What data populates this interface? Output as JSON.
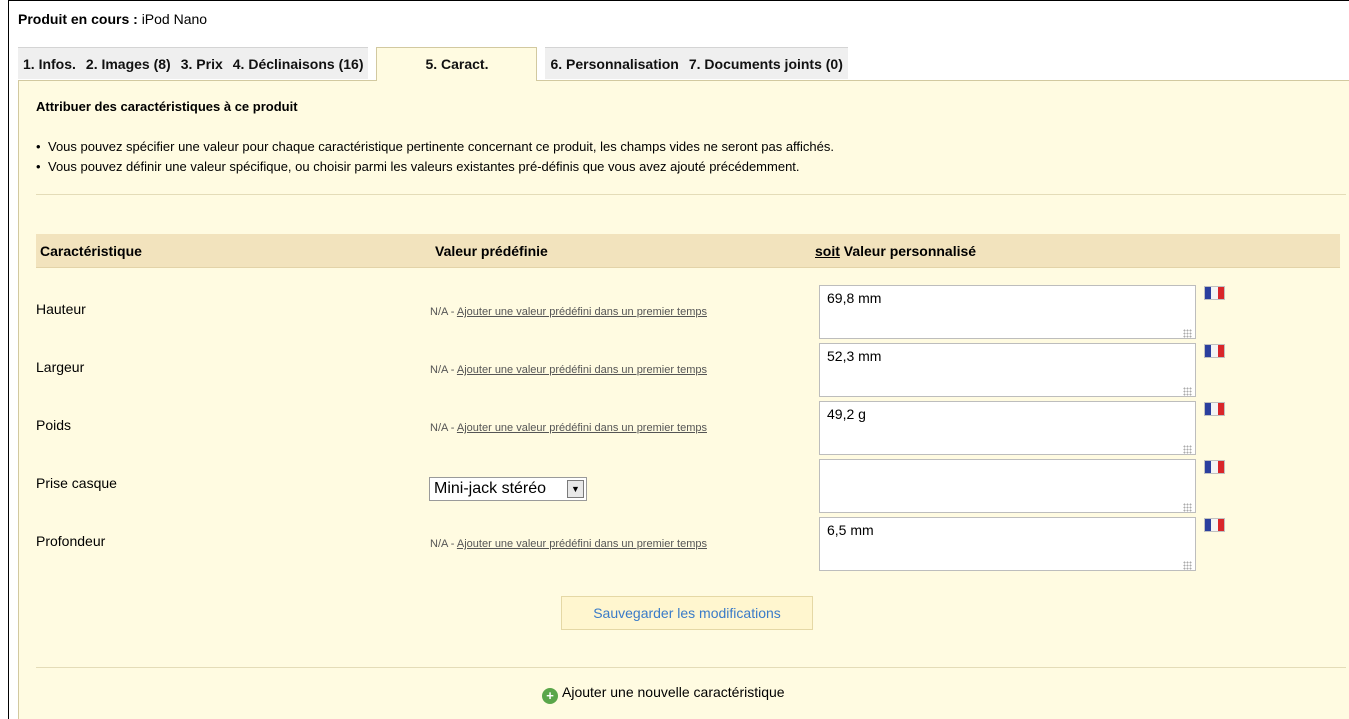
{
  "product": {
    "label": "Produit en cours :",
    "name": "iPod Nano"
  },
  "tabs": [
    {
      "label": "1. Infos."
    },
    {
      "label": "2. Images (8)"
    },
    {
      "label": "3. Prix"
    },
    {
      "label": "4. Déclinaisons (16)"
    },
    {
      "label": "5. Caract.",
      "active": true
    },
    {
      "label": "6. Personnalisation"
    },
    {
      "label": "7. Documents joints (0)"
    }
  ],
  "section": {
    "title": "Attribuer des caractéristiques à ce produit",
    "bullets": [
      "Vous pouvez spécifier une valeur pour chaque caractéristique pertinente concernant ce produit, les champs vides ne seront pas affichés.",
      "Vous pouvez définir une valeur spécifique, ou choisir parmi les valeurs existantes pré-définis que vous avez ajouté précédemment."
    ]
  },
  "table": {
    "headers": {
      "feature": "Caractéristique",
      "predefined": "Valeur prédéfinie",
      "soit": "soit",
      "custom": "Valeur personnalisé"
    },
    "na_text": "N/A -",
    "na_link": "Ajouter une valeur prédéfini dans un premier temps",
    "rows": [
      {
        "name": "Hauteur",
        "custom_value": "69,8 mm"
      },
      {
        "name": "Largeur",
        "custom_value": "52,3 mm"
      },
      {
        "name": "Poids",
        "custom_value": "49,2 g"
      },
      {
        "name": "Prise casque",
        "predefined_select": "Mini-jack stéréo",
        "custom_value": ""
      },
      {
        "name": "Profondeur",
        "custom_value": "6,5 mm"
      }
    ]
  },
  "save_button": "Sauvegarder les modifications",
  "add_feature": "Ajouter une nouvelle caractéristique",
  "colors": {
    "panel_bg": "#fffbe1",
    "header_bg": "#f2e3bd",
    "link_blue": "#3a7bc8"
  },
  "icons": {
    "flag": "france-flag-icon",
    "add": "plus-circle-icon",
    "select_arrow": "chevron-down-icon"
  }
}
